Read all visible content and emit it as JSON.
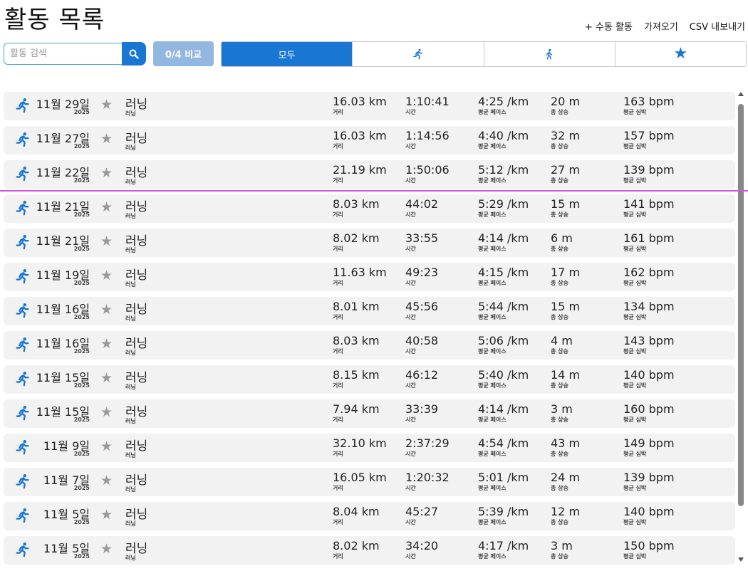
{
  "title": "활동 목록",
  "top_actions": {
    "manual": "+ 수동 활동",
    "import": "가져오기",
    "export": "CSV 내보내기"
  },
  "search": {
    "placeholder": "활동 검색"
  },
  "compare_label": "0/4 비교",
  "filters": {
    "all_label": "모두",
    "run_icon": "running-icon",
    "walk_icon": "walking-icon",
    "favorite_icon": "star-icon"
  },
  "colors": {
    "accent": "#1976d2",
    "compare_bg": "#92b7e0",
    "row_bg": "#f2f2f2",
    "star_gray": "#999999",
    "guide_line": "#d84ee6"
  },
  "stat_labels": {
    "distance": "거리",
    "time": "시간",
    "pace": "평균 페이스",
    "elevation": "총 상승",
    "hr": "평균 심박"
  },
  "activities": [
    {
      "date": "11월 29일",
      "year": "2025",
      "name": "러닝",
      "sub": "러닝",
      "distance": "16.03 km",
      "time": "1:10:41",
      "pace": "4:25 /km",
      "elevation": "20 m",
      "hr": "163 bpm"
    },
    {
      "date": "11월 27일",
      "year": "2025",
      "name": "러닝",
      "sub": "러닝",
      "distance": "16.03 km",
      "time": "1:14:56",
      "pace": "4:40 /km",
      "elevation": "32 m",
      "hr": "157 bpm"
    },
    {
      "date": "11월 22일",
      "year": "2025",
      "name": "러닝",
      "sub": "러닝",
      "distance": "21.19 km",
      "time": "1:50:06",
      "pace": "5:12 /km",
      "elevation": "27 m",
      "hr": "139 bpm"
    },
    {
      "date": "11월 21일",
      "year": "2025",
      "name": "러닝",
      "sub": "러닝",
      "distance": "8.03 km",
      "time": "44:02",
      "pace": "5:29 /km",
      "elevation": "15 m",
      "hr": "141 bpm"
    },
    {
      "date": "11월 21일",
      "year": "2025",
      "name": "러닝",
      "sub": "러닝",
      "distance": "8.02 km",
      "time": "33:55",
      "pace": "4:14 /km",
      "elevation": "6 m",
      "hr": "161 bpm"
    },
    {
      "date": "11월 19일",
      "year": "2025",
      "name": "러닝",
      "sub": "러닝",
      "distance": "11.63 km",
      "time": "49:23",
      "pace": "4:15 /km",
      "elevation": "17 m",
      "hr": "162 bpm"
    },
    {
      "date": "11월 16일",
      "year": "2025",
      "name": "러닝",
      "sub": "러닝",
      "distance": "8.01 km",
      "time": "45:56",
      "pace": "5:44 /km",
      "elevation": "15 m",
      "hr": "134 bpm"
    },
    {
      "date": "11월 16일",
      "year": "2025",
      "name": "러닝",
      "sub": "러닝",
      "distance": "8.03 km",
      "time": "40:58",
      "pace": "5:06 /km",
      "elevation": "4 m",
      "hr": "143 bpm"
    },
    {
      "date": "11월 15일",
      "year": "2025",
      "name": "러닝",
      "sub": "러닝",
      "distance": "8.15 km",
      "time": "46:12",
      "pace": "5:40 /km",
      "elevation": "14 m",
      "hr": "140 bpm"
    },
    {
      "date": "11월 15일",
      "year": "2025",
      "name": "러닝",
      "sub": "러닝",
      "distance": "7.94 km",
      "time": "33:39",
      "pace": "4:14 /km",
      "elevation": "3 m",
      "hr": "160 bpm"
    },
    {
      "date": "11월 9일",
      "year": "2025",
      "name": "러닝",
      "sub": "러닝",
      "distance": "32.10 km",
      "time": "2:37:29",
      "pace": "4:54 /km",
      "elevation": "43 m",
      "hr": "149 bpm"
    },
    {
      "date": "11월 7일",
      "year": "2025",
      "name": "러닝",
      "sub": "러닝",
      "distance": "16.05 km",
      "time": "1:20:32",
      "pace": "5:01 /km",
      "elevation": "24 m",
      "hr": "139 bpm"
    },
    {
      "date": "11월 5일",
      "year": "2025",
      "name": "러닝",
      "sub": "러닝",
      "distance": "8.04 km",
      "time": "45:27",
      "pace": "5:39 /km",
      "elevation": "12 m",
      "hr": "140 bpm"
    },
    {
      "date": "11월 5일",
      "year": "2025",
      "name": "러닝",
      "sub": "러닝",
      "distance": "8.02 km",
      "time": "34:20",
      "pace": "4:17 /km",
      "elevation": "3 m",
      "hr": "150 bpm"
    }
  ]
}
